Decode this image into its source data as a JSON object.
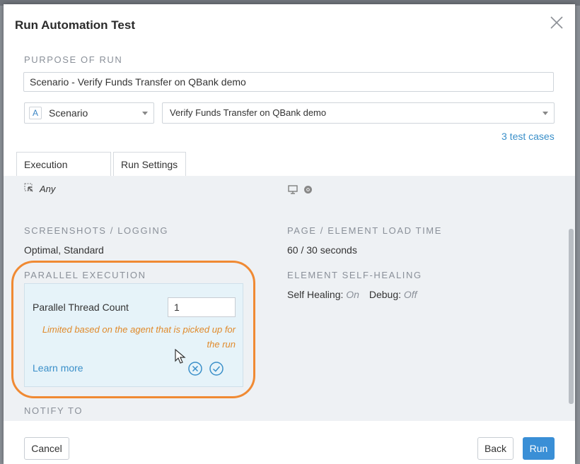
{
  "dialog": {
    "title": "Run Automation Test"
  },
  "purpose": {
    "label": "PURPOSE OF RUN",
    "value": "Scenario -  Verify Funds Transfer on QBank demo"
  },
  "scope_select": {
    "badge": "A",
    "value": "Scenario"
  },
  "scenario_select": {
    "value": "Verify Funds Transfer on QBank demo"
  },
  "test_cases_link": "3 test cases",
  "tabs": [
    {
      "label": "Execution Params",
      "active": false
    },
    {
      "label": "Run Settings",
      "active": true
    }
  ],
  "agent": {
    "value": "Any"
  },
  "screenshots": {
    "label": "SCREENSHOTS / LOGGING",
    "value": "Optimal, Standard"
  },
  "load_time": {
    "label": "PAGE / ELEMENT LOAD TIME",
    "value": "60 / 30 seconds"
  },
  "parallel": {
    "label": "PARALLEL EXECUTION",
    "thread_label": "Parallel Thread Count",
    "thread_value": "1",
    "warning_line1": "Limited based on the agent that is picked up for",
    "warning_line2": "the run",
    "learn_more": "Learn more"
  },
  "self_healing": {
    "label": "ELEMENT SELF-HEALING",
    "self_healing_label": "Self Healing:",
    "self_healing_value": "On",
    "debug_label": "Debug:",
    "debug_value": "Off"
  },
  "notify": {
    "label": "NOTIFY TO"
  },
  "footer": {
    "cancel": "Cancel",
    "back": "Back",
    "run": "Run"
  },
  "colors": {
    "accent": "#3a8fd6",
    "link": "#3a8fc9",
    "warning": "#e08a2b",
    "highlight": "#f08a33"
  }
}
